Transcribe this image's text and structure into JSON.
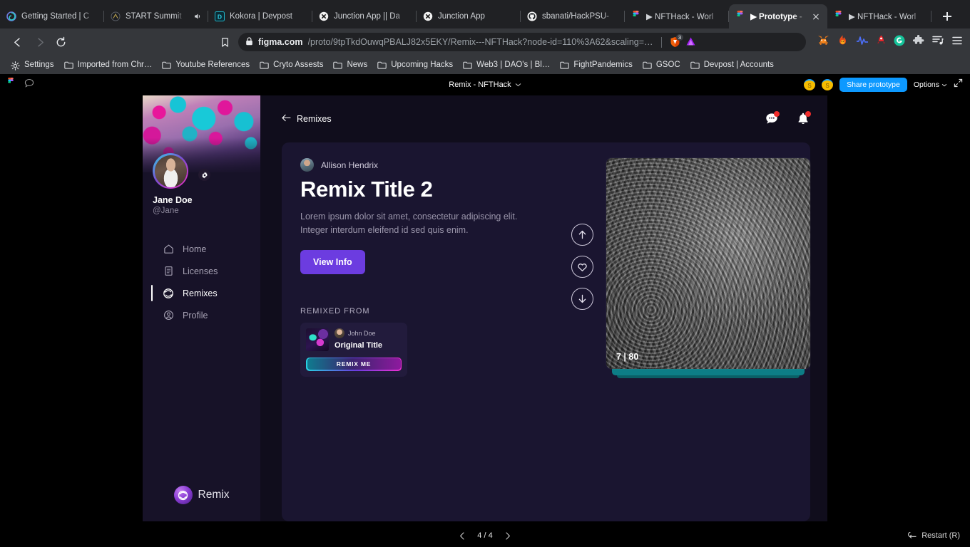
{
  "browser": {
    "tabs": [
      {
        "title": "Getting Started | C",
        "icon": "spiral-icon",
        "active": false
      },
      {
        "title": "START Summit",
        "icon": "circle-icon",
        "active": false,
        "audio": true
      },
      {
        "title": "Kokora | Devpost",
        "icon": "devpost-icon",
        "active": false
      },
      {
        "title": "Junction App || Da",
        "icon": "x-circle-icon",
        "active": false
      },
      {
        "title": "Junction App",
        "icon": "x-circle-icon",
        "active": false
      },
      {
        "title": "sbanati/HackPSU-",
        "icon": "github-icon",
        "active": false
      },
      {
        "title": "▶ NFTHack - Worl",
        "icon": "figma-icon",
        "active": false
      },
      {
        "title": "▶ Prototype - ",
        "icon": "figma-icon",
        "active": true
      },
      {
        "title": "▶ NFTHack - Worl",
        "icon": "figma-icon",
        "active": false
      }
    ],
    "new_tab_label": "+",
    "nav": {
      "back": "back-arrow",
      "forward": "forward-arrow",
      "reload": "reload-arrow",
      "bookmark": "bookmark-outline"
    },
    "omnibox": {
      "lock_icon": "lock-icon",
      "host": "figma.com",
      "path": "/proto/9tpTkdOuwqPBALJ82x5EKY/Remix---NFTHack?node-id=110%3A62&scaling=…",
      "brave_shield_count": "3"
    },
    "extensions": [
      "metamask-fox-icon",
      "fire-icon",
      "pulse-icon",
      "rocket-icon",
      "grammarly-icon",
      "puzzle-icon",
      "reading-list-icon",
      "menu-icon"
    ],
    "bookmarks": [
      {
        "label": "Settings",
        "icon": "gear-icon"
      },
      {
        "label": "Imported from Chr…",
        "icon": "folder-icon"
      },
      {
        "label": "Youtube References",
        "icon": "folder-icon"
      },
      {
        "label": "Cryto Assests",
        "icon": "folder-icon"
      },
      {
        "label": "News",
        "icon": "folder-icon"
      },
      {
        "label": "Upcoming Hacks",
        "icon": "folder-icon"
      },
      {
        "label": "Web3 | DAO's | Bl…",
        "icon": "folder-icon"
      },
      {
        "label": "FightPandemics",
        "icon": "folder-icon"
      },
      {
        "label": "GSOC",
        "icon": "folder-icon"
      },
      {
        "label": "Devpost | Accounts",
        "icon": "folder-icon"
      }
    ]
  },
  "figma": {
    "file_title": "Remix - NFTHack",
    "comment_icon": "comment-icon",
    "logo_icon": "figma-logo-icon",
    "collaborators": [
      "S",
      "S"
    ],
    "share_label": "Share prototype",
    "options_label": "Options",
    "fullscreen_icon": "fullscreen-icon",
    "footer": {
      "prev_icon": "chevron-left-icon",
      "next_icon": "chevron-right-icon",
      "page_indicator": "4 / 4",
      "restart_label": "Restart (R)",
      "restart_icon": "restart-arrow-icon"
    }
  },
  "app": {
    "sidebar": {
      "user_name": "Jane Doe",
      "user_handle": "@Jane",
      "settings_icon": "gear-icon",
      "nav": [
        {
          "label": "Home",
          "icon": "home-icon",
          "active": false
        },
        {
          "label": "Licenses",
          "icon": "document-icon",
          "active": false
        },
        {
          "label": "Remixes",
          "icon": "remix-refresh-icon",
          "active": true
        },
        {
          "label": "Profile",
          "icon": "user-circle-icon",
          "active": false
        }
      ],
      "brand": "Remix"
    },
    "header": {
      "back_label": "Remixes",
      "back_icon": "arrow-left-icon",
      "messages_icon": "chat-bubble-icon",
      "notifications_icon": "bell-icon"
    },
    "detail": {
      "author": "Allison Hendrix",
      "title": "Remix Title 2",
      "description": "Lorem ipsum dolor sit amet, consectetur adipiscing elit. Integer interdum eleifend id sed quis enim.",
      "view_info_label": "View Info",
      "remixed_from_label": "REMIXED FROM",
      "source": {
        "user": "John Doe",
        "title": "Original Title",
        "remix_button_label": "REMIX ME"
      },
      "nft": {
        "count_label": "7 | 80",
        "upvote_icon": "arrow-up-circle-icon",
        "like_icon": "heart-circle-icon",
        "downvote_icon": "arrow-down-circle-icon"
      }
    },
    "colors": {
      "accent_purple": "#6c3ce0",
      "panel_bg": "#1a1530",
      "sidebar_bg": "#171228",
      "teal": "#0d7d86"
    }
  }
}
